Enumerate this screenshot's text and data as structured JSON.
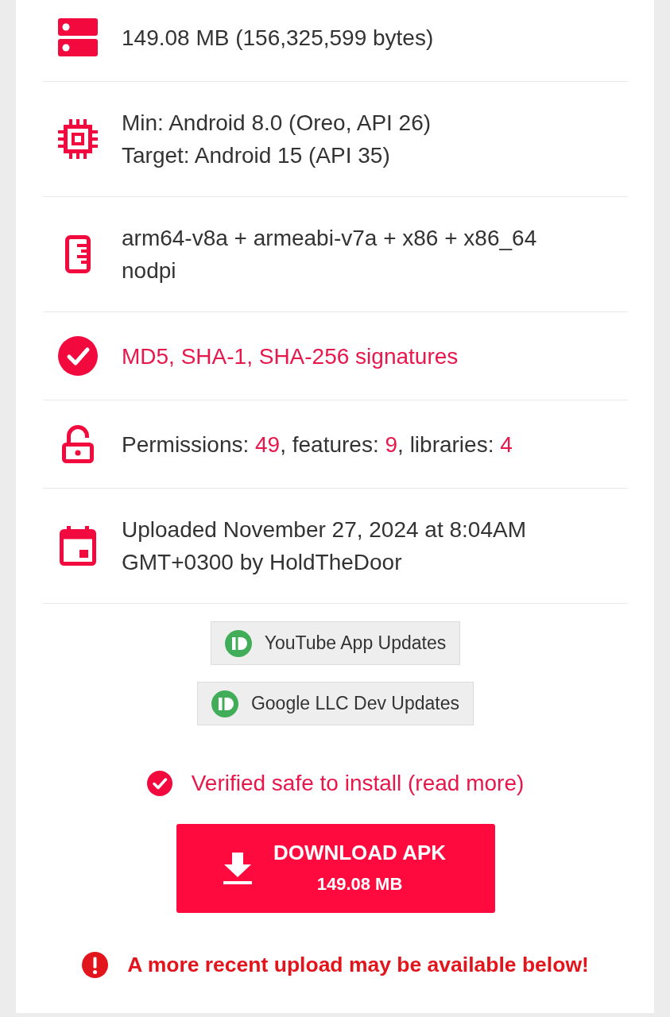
{
  "details": [
    {
      "kind": "size",
      "link": false,
      "lines": [
        "149.08 MB (156,325,599 bytes)"
      ]
    },
    {
      "kind": "sdk",
      "link": false,
      "lines": [
        "Min: Android 8.0 (Oreo, API 26)",
        "Target: Android 15 (API 35)"
      ]
    },
    {
      "kind": "abi",
      "link": false,
      "lines": [
        "arm64-v8a + armeabi-v7a + x86 + x86_64",
        "nodpi"
      ]
    },
    {
      "kind": "signatures",
      "link": true,
      "lines": [
        "MD5, SHA-1, SHA-256 signatures"
      ]
    },
    {
      "kind": "permissions",
      "link": false,
      "parts": [
        {
          "text": "Permissions: ",
          "link": false
        },
        {
          "text": "49",
          "link": true
        },
        {
          "text": ", features: ",
          "link": false
        },
        {
          "text": "9",
          "link": true
        },
        {
          "text": ", libraries: ",
          "link": false
        },
        {
          "text": "4",
          "link": true
        }
      ]
    },
    {
      "kind": "uploaded",
      "link": false,
      "lines": [
        "Uploaded November 27, 2024 at 8:04AM",
        "GMT+0300 by HoldTheDoor"
      ]
    }
  ],
  "tags": [
    {
      "label": "YouTube App Updates"
    },
    {
      "label": "Google LLC Dev Updates"
    }
  ],
  "verified": {
    "text": "Verified safe to install (read more)"
  },
  "download": {
    "title": "DOWNLOAD APK",
    "size": "149.08 MB"
  },
  "notice": {
    "text": "A more recent upload may be available below!"
  }
}
